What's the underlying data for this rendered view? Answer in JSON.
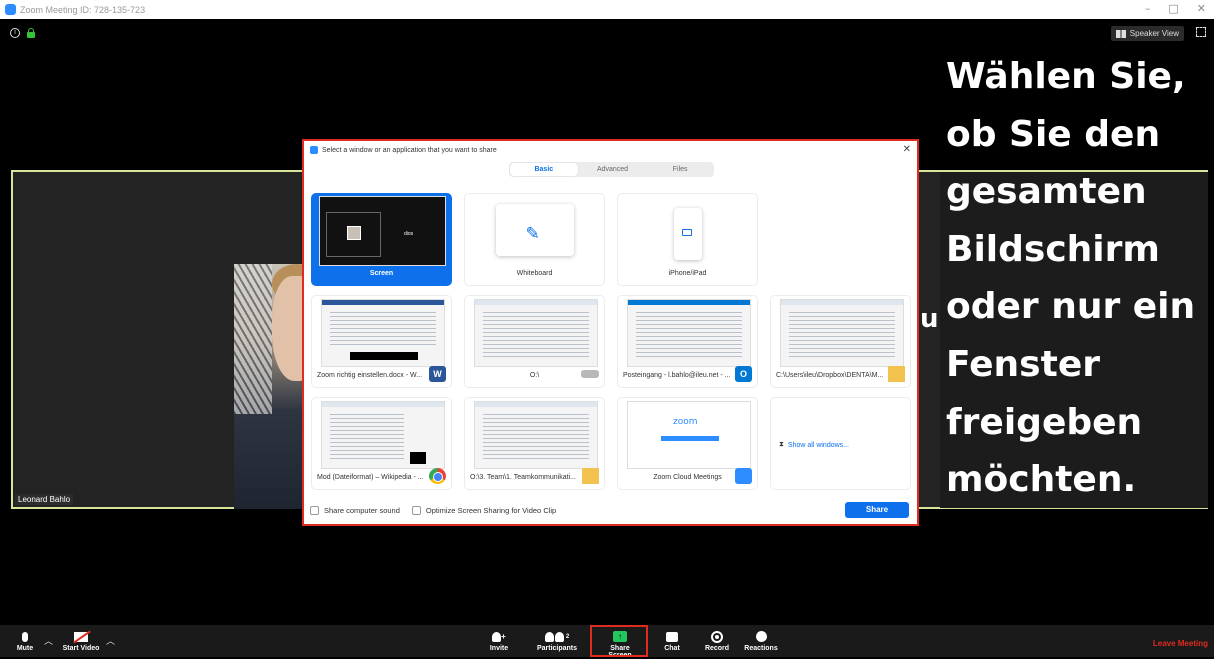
{
  "window": {
    "title": "Zoom Meeting ID: 728-135-723",
    "controls": [
      "–",
      "□",
      "✕"
    ]
  },
  "top_bar": {
    "speaker_view_label": "Speaker View"
  },
  "participant": {
    "name": "Leonard Bahlo"
  },
  "overlay": {
    "stray_char": "u",
    "lines": [
      "Wählen Sie,",
      "ob Sie den",
      "gesamten",
      "Bildschirm",
      "oder nur ein",
      "Fenster",
      "freigeben",
      "möchten."
    ]
  },
  "share_dialog": {
    "title": "Select a window or an application that you want to share",
    "close": "✕",
    "tabs": [
      {
        "label": "Basic",
        "active": true
      },
      {
        "label": "Advanced",
        "active": false
      },
      {
        "label": "Files",
        "active": false
      }
    ],
    "tiles": [
      {
        "label": "Screen",
        "selected": true,
        "thumb_text": "dios"
      },
      {
        "label": "Whiteboard",
        "selected": false
      },
      {
        "label": "iPhone/iPad",
        "selected": false
      },
      {
        "label": "Zoom richtig einstellen.docx - W...",
        "badge": "W"
      },
      {
        "label": "O:\\",
        "badge": ""
      },
      {
        "label": "Posteingang - l.bahlo@ileu.net - ...",
        "badge": "O"
      },
      {
        "label": "C:\\Users\\ileu\\Dropbox\\DENTA\\M...",
        "badge": ""
      },
      {
        "label": "Mod (Dateiformat) – Wikipedia - ...",
        "badge": ""
      },
      {
        "label": "O:\\3. Team\\1. Teamkommunikati...",
        "badge": ""
      },
      {
        "label": "Zoom Cloud Meetings",
        "badge": "",
        "thumb_logo": "zoom"
      }
    ],
    "show_all": "Show all windows...",
    "footer": {
      "share_sound": "Share computer sound",
      "optimize": "Optimize Screen Sharing for Video Clip",
      "share_button": "Share"
    }
  },
  "toolbar": {
    "mute": "Mute",
    "start_video": "Start Video",
    "invite": "Invite",
    "participants": "Participants",
    "participants_count": "2",
    "share_screen": "Share Screen",
    "chat": "Chat",
    "record": "Record",
    "reactions": "Reactions",
    "leave": "Leave Meeting"
  }
}
